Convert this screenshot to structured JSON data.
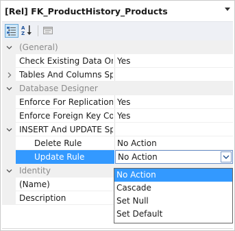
{
  "object_selector": {
    "label": "[Rel] FK_ProductHistory_Products"
  },
  "toolbar": {
    "categorized_icon": "categorized-icon",
    "alphabetical_icon": "alphabetical-icon",
    "property_pages_icon": "property-pages-icon"
  },
  "grid": {
    "general": {
      "label": "(General)",
      "check_existing": {
        "name": "Check Existing Data On C",
        "value": "Yes"
      },
      "tables_columns": {
        "name": "Tables And Columns Spe",
        "value": ""
      }
    },
    "database_designer": {
      "label": "Database Designer",
      "enforce_replication": {
        "name": "Enforce For Replication",
        "value": "Yes"
      },
      "enforce_fk": {
        "name": "Enforce Foreign Key Con",
        "value": "Yes"
      },
      "insert_update": {
        "name": "INSERT And UPDATE Spe",
        "value": ""
      },
      "delete_rule": {
        "name": "Delete Rule",
        "value": "No Action"
      },
      "update_rule": {
        "name": "Update Rule",
        "value": "No Action"
      }
    },
    "identity": {
      "label": "Identity",
      "name_row": {
        "name": "(Name)",
        "value": ""
      },
      "description": {
        "name": "Description",
        "value": ""
      }
    }
  },
  "dropdown": {
    "options": [
      "No Action",
      "Cascade",
      "Set Null",
      "Set Default"
    ],
    "selected": "No Action"
  },
  "colors": {
    "selection": "#3399ff",
    "category_bg": "#f0f0f0",
    "category_text": "#8a8a8a"
  }
}
